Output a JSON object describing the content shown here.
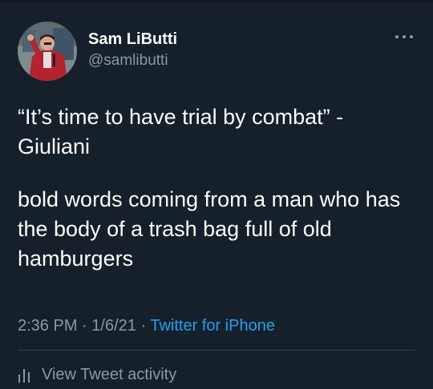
{
  "tweet": {
    "author": {
      "name": "Sam LiButti",
      "handle": "@samlibutti",
      "avatar_icon": "profile-photo"
    },
    "more_icon": "more-horizontal-icon",
    "paragraphs": [
      "“It’s time to have trial by combat” - Giuliani",
      "bold words coming from a man who has the body of a trash bag full of old hamburgers"
    ],
    "time": "2:36 PM",
    "date": "1/6/21",
    "separator": "·",
    "source": "Twitter for iPhone"
  },
  "actions": {
    "activity_label": "View Tweet activity",
    "activity_icon": "analytics-bars-icon"
  },
  "colors": {
    "background": "#15202b",
    "text": "#ffffff",
    "muted": "#8899a6",
    "link": "#1da1f2",
    "divider": "#38444d"
  }
}
